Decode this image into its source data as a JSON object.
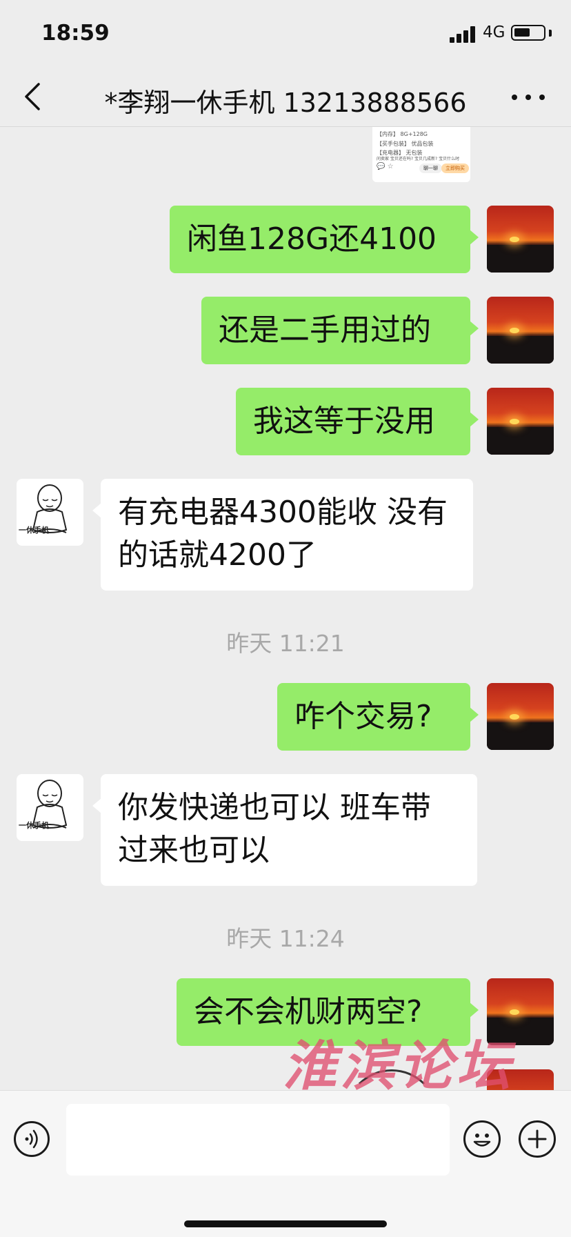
{
  "status_bar": {
    "time": "18:59",
    "network": "4G",
    "battery_level": 0.55
  },
  "nav": {
    "back_icon": "chevron-left-icon",
    "title": "*李翔一休手机 13213888566",
    "more_icon": "ellipsis-icon"
  },
  "card": {
    "line1": "【内存】 8G+128G",
    "line2": "【买手包装】 优品包装",
    "line3": "【充电器】 无包装",
    "line4": "问卖家   宝贝还在吗?   宝贝几成新?   宝贝什么时",
    "btn_a": "聊一聊",
    "btn_b": "立即购买"
  },
  "messages": [
    {
      "dir": "out",
      "text": "闲鱼128G还4100"
    },
    {
      "dir": "out",
      "text": "还是二手用过的"
    },
    {
      "dir": "out",
      "text": "我这等于没用"
    },
    {
      "dir": "in",
      "text": "有充电器4300能收  没有的话就4200了"
    },
    {
      "dir": "out",
      "text": "咋个交易?"
    },
    {
      "dir": "in",
      "text": "你发快递也可以 班车带过来也可以"
    },
    {
      "dir": "out",
      "text": "会不会机财两空?"
    }
  ],
  "timestamps": [
    "昨天 11:21",
    "昨天 11:24"
  ],
  "contact_avatar": {
    "caption": "一休手机"
  },
  "watermark": "淮滨论坛",
  "input_bar": {
    "voice_icon": "voice-icon",
    "emoji_icon": "smiley-icon",
    "plus_icon": "plus-icon",
    "placeholder": ""
  },
  "colors": {
    "background": "#ededed",
    "out_bubble": "#95ec69",
    "in_bubble": "#ffffff",
    "timestamp": "#a8a8a8"
  }
}
